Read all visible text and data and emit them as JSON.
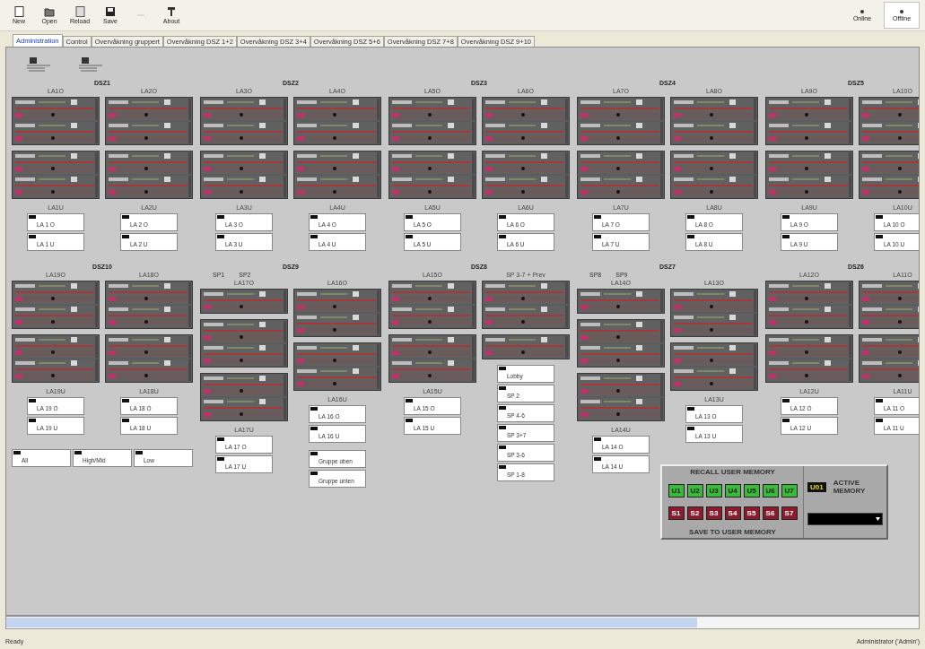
{
  "toolbar": {
    "buttons": [
      {
        "kind": "new",
        "label": "New",
        "disabled": false
      },
      {
        "kind": "open",
        "label": "Open",
        "disabled": false
      },
      {
        "kind": "reload",
        "label": "Reload",
        "disabled": false
      },
      {
        "kind": "save",
        "label": "Save",
        "disabled": false
      },
      {
        "kind": "undo",
        "disabled": true
      },
      {
        "kind": "about",
        "label": "About",
        "disabled": false
      }
    ],
    "modes": [
      {
        "label": "Online",
        "selected": false
      },
      {
        "label": "Offline",
        "selected": true
      }
    ]
  },
  "tabs": [
    {
      "label": "Administration",
      "selected": true
    },
    {
      "label": "Control",
      "selected": false
    },
    {
      "label": "Overvåkning gruppert",
      "selected": false
    },
    {
      "label": "Overvåkning DSZ 1+2",
      "selected": false
    },
    {
      "label": "Overvåkning DSZ 3+4",
      "selected": false
    },
    {
      "label": "Overvåkning DSZ 5+6",
      "selected": false
    },
    {
      "label": "Overvåkning DSZ 7+8",
      "selected": false
    },
    {
      "label": "Overvåkning DSZ 9+10",
      "selected": false
    }
  ],
  "zone_rows": [
    [
      {
        "title": "DSZ1",
        "columns": [
          {
            "label": "LA1O",
            "blocks": [
              {
                "kind": "pair"
              },
              {
                "kind": "pair"
              }
            ],
            "sub_label": "LA1U",
            "field_groups": [
              [
                "LA 1 O",
                "LA 1 U"
              ]
            ]
          },
          {
            "label": "LA2O",
            "blocks": [
              {
                "kind": "pair"
              },
              {
                "kind": "pair"
              }
            ],
            "sub_label": "LA2U",
            "field_groups": [
              [
                "LA 2 O",
                "LA 2 U"
              ]
            ]
          }
        ]
      },
      {
        "title": "DSZ2",
        "columns": [
          {
            "label": "LA3O",
            "blocks": [
              {
                "kind": "pair"
              },
              {
                "kind": "pair"
              }
            ],
            "sub_label": "LA3U",
            "field_groups": [
              [
                "LA 3 O",
                "LA 3 U"
              ]
            ]
          },
          {
            "label": "LA4O",
            "blocks": [
              {
                "kind": "pair"
              },
              {
                "kind": "pair"
              }
            ],
            "sub_label": "LA4U",
            "field_groups": [
              [
                "LA 4 O",
                "LA 4 U"
              ]
            ]
          }
        ]
      },
      {
        "title": "DSZ3",
        "columns": [
          {
            "label": "LA5O",
            "blocks": [
              {
                "kind": "pair"
              },
              {
                "kind": "pair"
              }
            ],
            "sub_label": "LA5U",
            "field_groups": [
              [
                "LA 5 O",
                "LA 5 U"
              ]
            ]
          },
          {
            "label": "LA6O",
            "blocks": [
              {
                "kind": "pair"
              },
              {
                "kind": "pair"
              }
            ],
            "sub_label": "LA6U",
            "field_groups": [
              [
                "LA 6 O",
                "LA 6 U"
              ]
            ]
          }
        ]
      },
      {
        "title": "DSZ4",
        "columns": [
          {
            "label": "LA7O",
            "blocks": [
              {
                "kind": "pair"
              },
              {
                "kind": "pair"
              }
            ],
            "sub_label": "LA7U",
            "field_groups": [
              [
                "LA 7 O",
                "LA 7 U"
              ]
            ]
          },
          {
            "label": "LA8O",
            "blocks": [
              {
                "kind": "pair"
              },
              {
                "kind": "pair"
              }
            ],
            "sub_label": "LA8U",
            "field_groups": [
              [
                "LA 8 O",
                "LA 8 U"
              ]
            ]
          }
        ]
      },
      {
        "title": "DSZ5",
        "columns": [
          {
            "label": "LA9O",
            "blocks": [
              {
                "kind": "pair"
              },
              {
                "kind": "pair"
              }
            ],
            "sub_label": "LA9U",
            "field_groups": [
              [
                "LA 9 O",
                "LA 9 U"
              ]
            ]
          },
          {
            "label": "LA10O",
            "blocks": [
              {
                "kind": "pair"
              },
              {
                "kind": "pair"
              }
            ],
            "sub_label": "LA10U",
            "field_groups": [
              [
                "LA 10 O",
                "LA 10 U"
              ]
            ]
          }
        ]
      }
    ],
    [
      {
        "title": "DSZ10",
        "columns": [
          {
            "label": "LA19O",
            "blocks": [
              {
                "kind": "pair"
              },
              {
                "kind": "pair"
              }
            ],
            "sub_label": "LA19U",
            "field_groups": [
              [
                "LA 19 O",
                "LA 19 U"
              ]
            ]
          },
          {
            "label": "LA18O",
            "blocks": [
              {
                "kind": "pair"
              },
              {
                "kind": "pair"
              }
            ],
            "sub_label": "LA18U",
            "field_groups": [
              [
                "LA 18 O",
                "LA 18 U"
              ]
            ]
          }
        ],
        "presets": [
          "All",
          "High/Mid",
          "Low"
        ]
      },
      {
        "title": "DSZ9",
        "markers": [
          "SP1",
          "SP2"
        ],
        "columns": [
          {
            "label": "LA17O",
            "blocks": [
              {
                "kind": "single"
              },
              {
                "kind": "pair"
              },
              {
                "kind": "pair"
              }
            ],
            "sub_label": "LA17U",
            "field_groups": [
              [
                "LA 17 O",
                "LA 17 U"
              ]
            ]
          },
          {
            "label": "LA16O",
            "blocks": [
              {
                "kind": "pair"
              },
              {
                "kind": "pair"
              }
            ],
            "sub_label": "LA16U",
            "field_groups": [
              [
                "LA 16 O",
                "LA 16 U"
              ],
              [
                "Gruppe oben",
                "Gruppe unten"
              ]
            ]
          }
        ]
      },
      {
        "title": "DSZ8",
        "columns": [
          {
            "label": "LA15O",
            "blocks": [
              {
                "kind": "pair"
              },
              {
                "kind": "pair"
              }
            ],
            "sub_label": "LA15U",
            "field_groups": [
              [
                "LA 15 O",
                "LA 15 U"
              ]
            ]
          },
          {
            "label": "SP 3-7 + Prev",
            "blocks": [
              {
                "kind": "pair"
              },
              {
                "kind": "single"
              }
            ],
            "field_groups": [
              [
                "Lobby",
                "SP 2",
                "SP 4-6",
                "SP 3+7",
                "SP 3-6",
                "SP 1-8"
              ]
            ]
          }
        ]
      },
      {
        "title": "DSZ7",
        "markers": [
          "SP8",
          "SP9"
        ],
        "columns": [
          {
            "label": "LA14O",
            "blocks": [
              {
                "kind": "single"
              },
              {
                "kind": "pair"
              },
              {
                "kind": "pair"
              }
            ],
            "sub_label": "LA14U",
            "field_groups": [
              [
                "LA 14 O",
                "LA 14 U"
              ]
            ]
          },
          {
            "label": "LA13O",
            "blocks": [
              {
                "kind": "pair"
              },
              {
                "kind": "pair"
              }
            ],
            "sub_label": "LA13U",
            "field_groups": [
              [
                "LA 13 O",
                "LA 13 U"
              ]
            ]
          }
        ]
      },
      {
        "title": "DSZ6",
        "columns": [
          {
            "label": "LA12O",
            "blocks": [
              {
                "kind": "pair"
              },
              {
                "kind": "pair"
              }
            ],
            "sub_label": "LA12U",
            "field_groups": [
              [
                "LA 12 O",
                "LA 12 U"
              ]
            ]
          },
          {
            "label": "LA11O",
            "blocks": [
              {
                "kind": "pair"
              },
              {
                "kind": "pair"
              }
            ],
            "sub_label": "LA11U",
            "field_groups": [
              [
                "LA 11 O",
                "LA 11 U"
              ]
            ]
          }
        ]
      }
    ]
  ],
  "memory": {
    "recall_title": "RECALL USER MEMORY",
    "recall_buttons": [
      "U1",
      "U2",
      "U3",
      "U4",
      "U5",
      "U6",
      "U7"
    ],
    "save_buttons": [
      "S1",
      "S2",
      "S3",
      "S4",
      "S5",
      "S6",
      "S7"
    ],
    "save_title": "SAVE TO USER MEMORY",
    "active_value": "U01",
    "active_label": "ACTIVE MEMORY"
  },
  "status_bar": {
    "left": "Ready",
    "right": "Administrator ('Admin')"
  }
}
